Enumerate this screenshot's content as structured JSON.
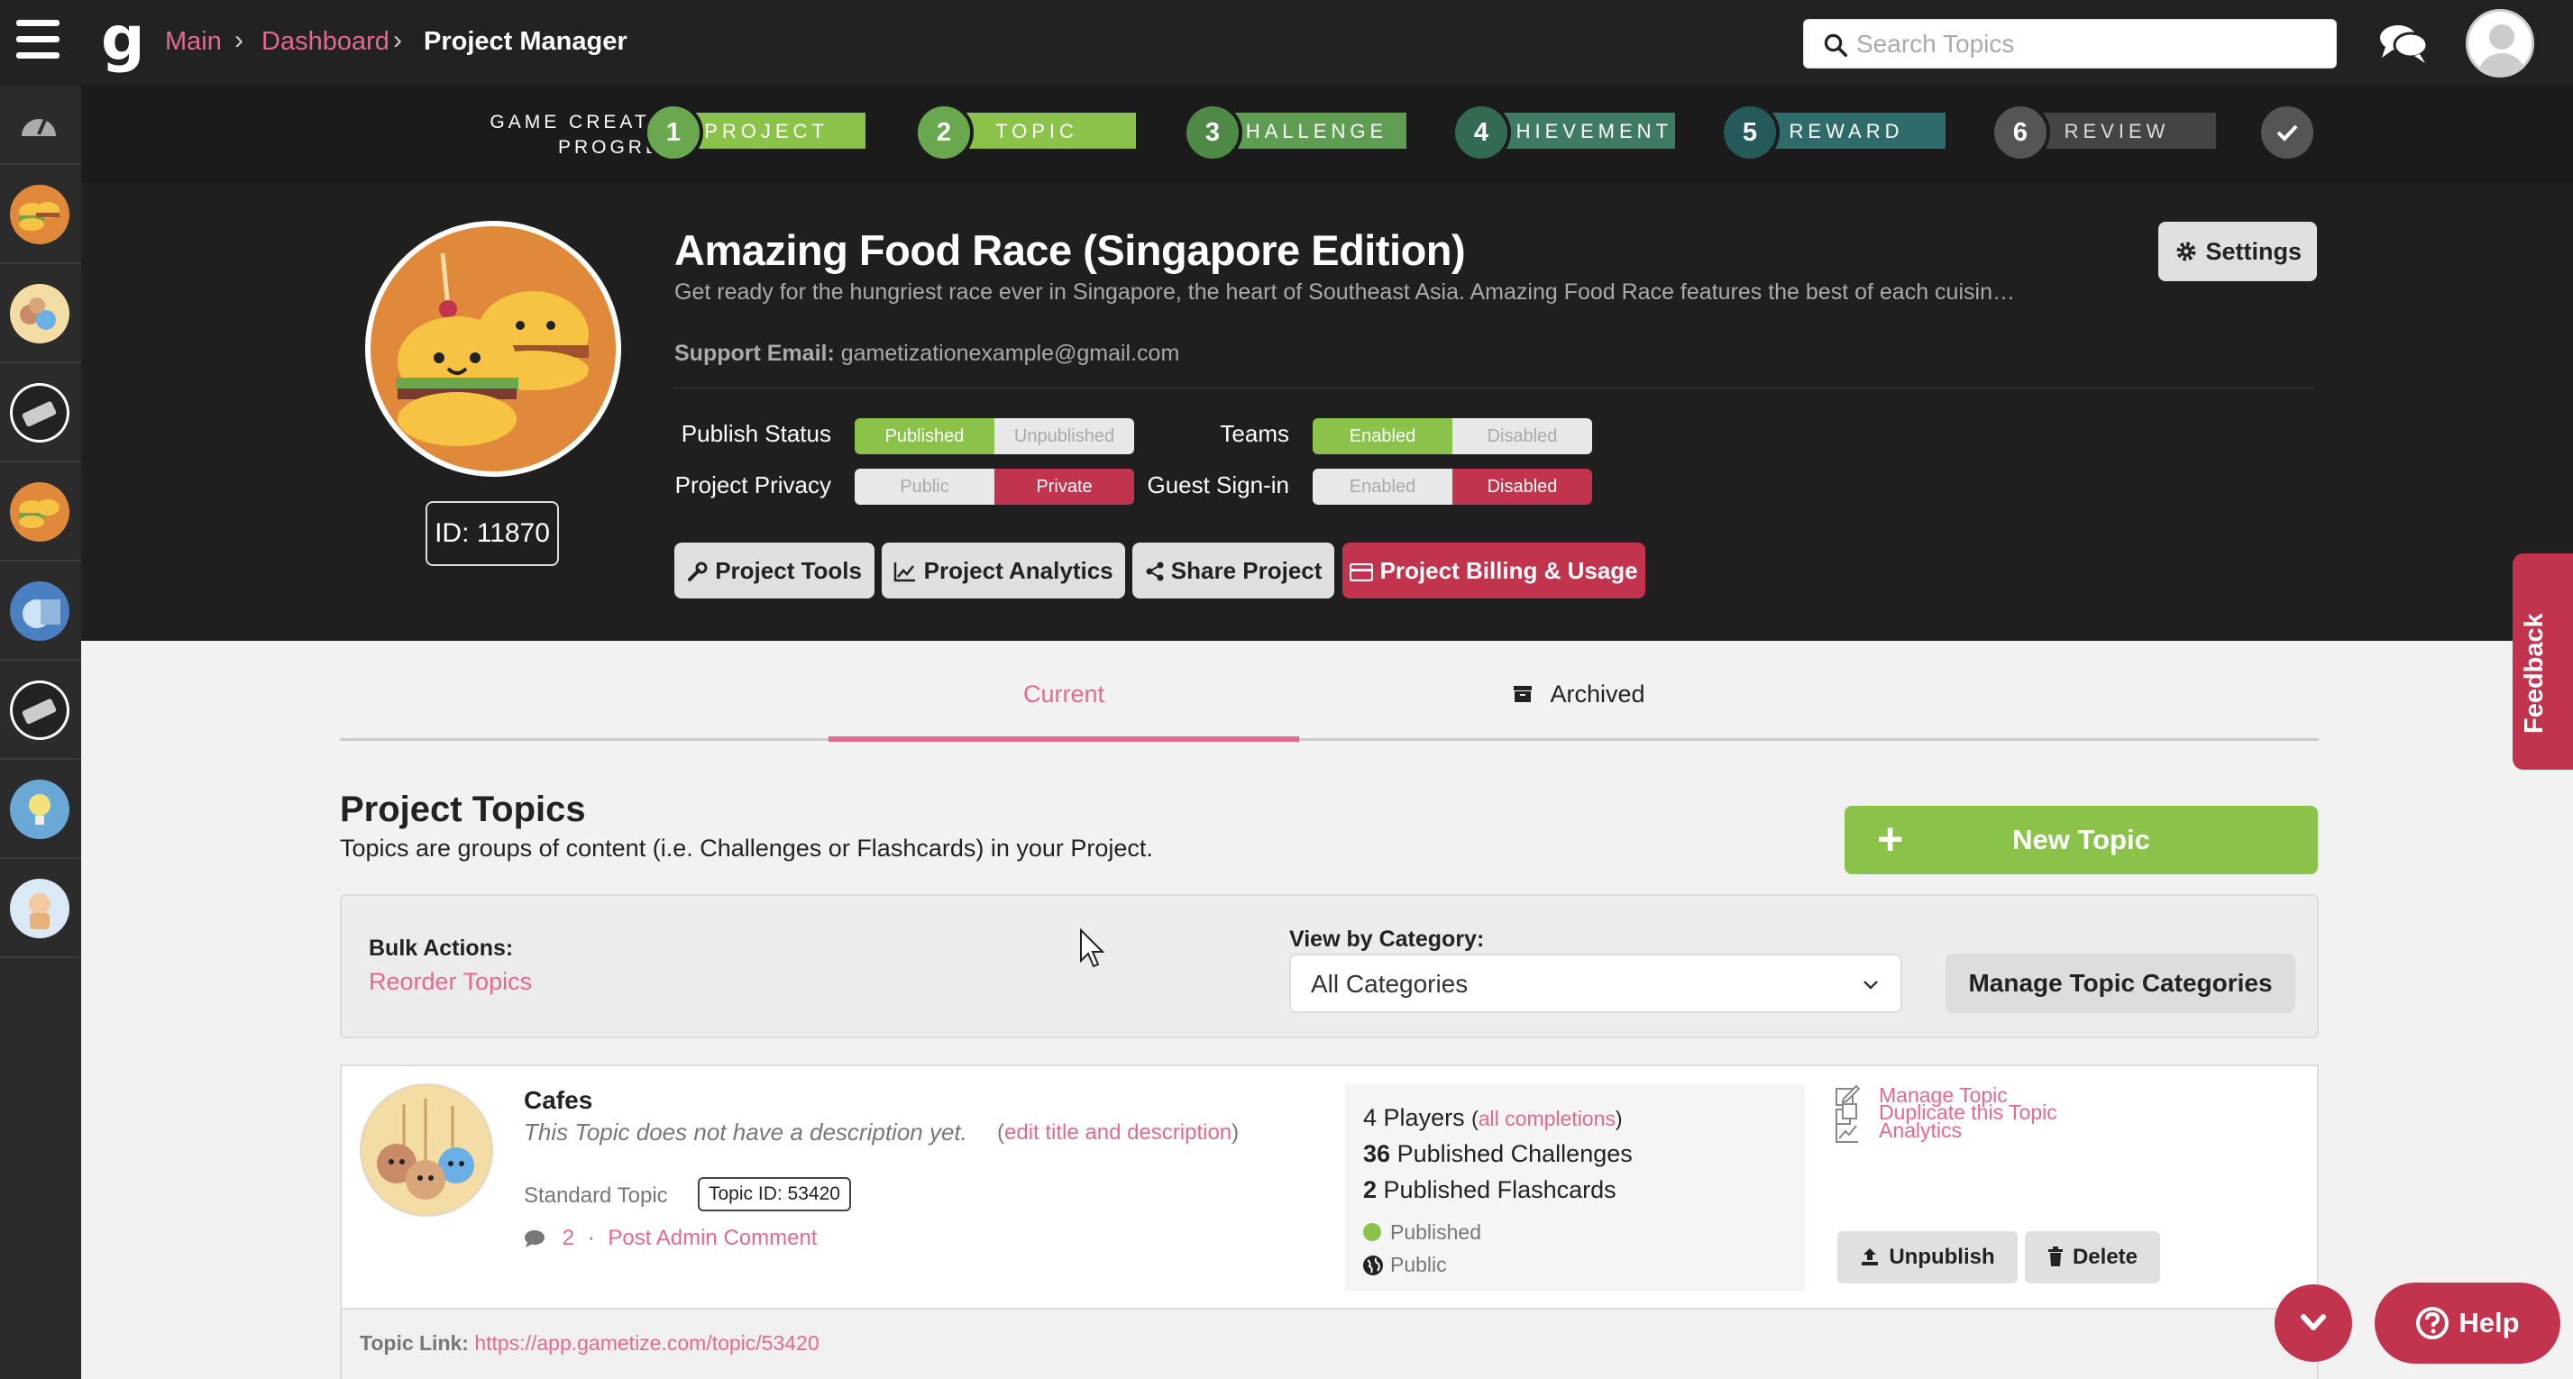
{
  "topbar": {
    "breadcrumb": [
      "Main",
      "Dashboard",
      "Project Manager"
    ],
    "search_placeholder": "Search Topics"
  },
  "progress": {
    "label_line1": "GAME CREATION",
    "label_line2": "PROGRESS",
    "steps": [
      {
        "num": "1",
        "label": "PROJECT",
        "color": "#8bc34a"
      },
      {
        "num": "2",
        "label": "TOPIC",
        "color": "#8bc34a"
      },
      {
        "num": "3",
        "label": "CHALLENGE",
        "color": "#5f9e52"
      },
      {
        "num": "4",
        "label": "ACHIEVEMENT",
        "color": "#3f7a63"
      },
      {
        "num": "5",
        "label": "REWARD",
        "color": "#2f6b6b"
      },
      {
        "num": "6",
        "label": "REVIEW",
        "color": "#555555"
      }
    ]
  },
  "project": {
    "title": "Amazing Food Race (Singapore Edition)",
    "description": "Get ready for the hungriest race ever in Singapore, the heart of Southeast Asia. Amazing Food Race features the best of each cuisine, recom…",
    "support_email_label": "Support Email:",
    "support_email": "gametizationexample@gmail.com",
    "id_label": "ID: 11870",
    "settings_label": "Settings",
    "publish_status": {
      "label": "Publish Status",
      "on": "Published",
      "off": "Unpublished",
      "value": "Published"
    },
    "privacy": {
      "label": "Project Privacy",
      "on": "Public",
      "off": "Private",
      "value": "Private"
    },
    "teams": {
      "label": "Teams",
      "on": "Enabled",
      "off": "Disabled",
      "value": "Enabled"
    },
    "guest_signin": {
      "label": "Guest Sign-in",
      "on": "Enabled",
      "off": "Disabled",
      "value": "Disabled"
    },
    "buttons": {
      "tools": "Project Tools",
      "analytics": "Project Analytics",
      "share": "Share Project",
      "billing": "Project Billing & Usage"
    }
  },
  "feedback_label": "Feedback",
  "tabs": {
    "current": "Current",
    "archived": "Archived"
  },
  "topics_section": {
    "title": "Project Topics",
    "subtitle": "Topics are groups of content (i.e. Challenges or Flashcards) in your Project.",
    "new_topic": "New Topic",
    "bulk_label": "Bulk Actions:",
    "reorder": "Reorder Topics",
    "category_label": "View by Category:",
    "category_value": "All Categories",
    "manage_categories": "Manage Topic Categories"
  },
  "topic": {
    "name": "Cafes",
    "description": "This Topic does not have a description yet.",
    "edit_link": "edit title and description",
    "type": "Standard Topic",
    "id_label": "Topic ID: 53420",
    "comment_count": "2",
    "post_comment": "Post Admin Comment",
    "players_count": "4",
    "players_label": "Players",
    "all_completions": "all completions",
    "challenges_count": "36",
    "challenges_label": "Published Challenges",
    "flashcards_count": "2",
    "flashcards_label": "Published Flashcards",
    "status": "Published",
    "privacy": "Public",
    "manage": "Manage Topic",
    "duplicate": "Duplicate this Topic",
    "analytics": "Analytics",
    "unpublish": "Unpublish",
    "delete": "Delete",
    "link_label": "Topic Link:",
    "link_url": "https://app.gametize.com/topic/53420"
  },
  "help_label": "Help"
}
